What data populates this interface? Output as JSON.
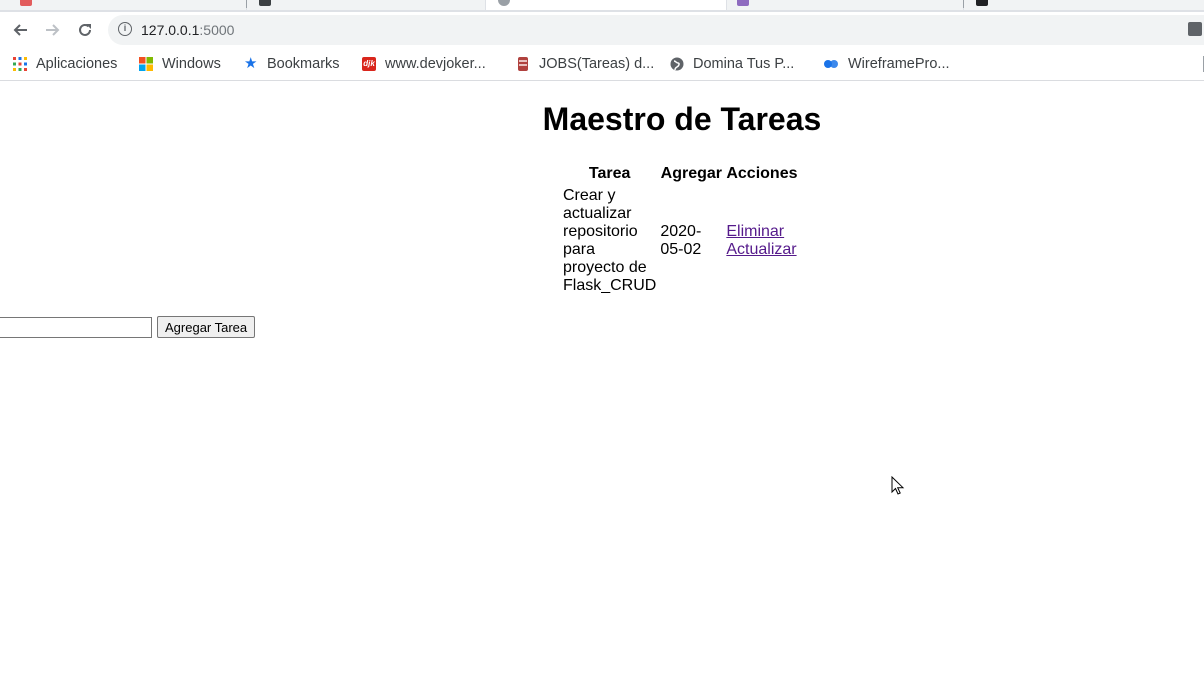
{
  "browser": {
    "url_host": "127.0.0.1",
    "url_port": ":5000",
    "bookmarks": [
      {
        "label": "Aplicaciones",
        "icon": "apps-grid-icon"
      },
      {
        "label": "Windows",
        "icon": "windows-logo-icon"
      },
      {
        "label": "Bookmarks",
        "icon": "star-icon"
      },
      {
        "label": "www.devjoker...",
        "icon": "devjoker-icon"
      },
      {
        "label": "JOBS(Tareas) d...",
        "icon": "database-icon"
      },
      {
        "label": "Domina Tus P...",
        "icon": "globe-icon"
      },
      {
        "label": "WireframePro...",
        "icon": "wireframepro-icon"
      }
    ]
  },
  "page": {
    "title": "Maestro de Tareas",
    "table": {
      "headers": [
        "Tarea",
        "Agregar",
        "Acciones"
      ],
      "rows": [
        {
          "task": "Crear y actualizar repositorio para proyecto de Flask_CRUD",
          "date": "2020-05-02",
          "delete_label": "Eliminar",
          "update_label": "Actualizar"
        }
      ]
    },
    "form": {
      "input_value": "",
      "submit_label": "Agregar Tarea"
    }
  },
  "colors": {
    "link": "#551a8b",
    "toolbar_bg": "#f1f3f4",
    "tabstrip_bg": "#dee1e6"
  }
}
